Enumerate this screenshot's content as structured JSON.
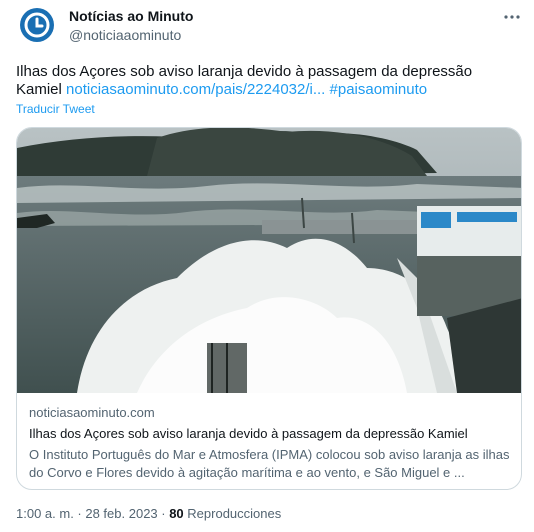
{
  "account": {
    "name": "Notícias ao Minuto",
    "handle": "@noticiaaominuto"
  },
  "tweet": {
    "text_line1": "Ilhas dos Açores sob aviso laranja devido à passagem da depressão",
    "text_line2_prefix": "Kamiel ",
    "link": "noticiasaominuto.com/pais/2224032/i...",
    "hashtag": "#paisaominuto",
    "translate_label": "Traducir Tweet"
  },
  "card": {
    "domain": "noticiasaominuto.com",
    "title": "Ilhas dos Açores sob aviso laranja devido à passagem da depressão Kamiel",
    "description": "O Instituto Português do Mar e Atmosfera (IPMA) colocou sob aviso laranja as ilhas do Corvo e Flores devido à agitação marítima e ao vento, e São Miguel e ..."
  },
  "meta": {
    "timestamp": "1:00 a. m. · 28 feb. 2023 · ",
    "views_count": "80",
    "views_label": " Reproducciones"
  },
  "colors": {
    "link": "#1d9bf0",
    "secondary_text": "#536471",
    "border": "#cfd9de",
    "avatar_bg": "#1a6fb3"
  },
  "icons": {
    "avatar": "clock-logo-icon",
    "more": "more-dots-icon"
  }
}
